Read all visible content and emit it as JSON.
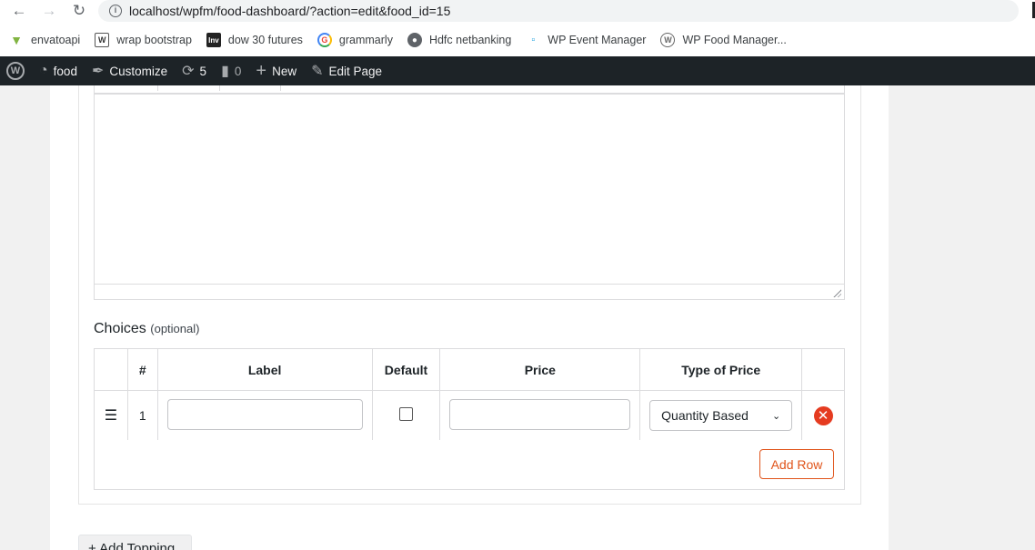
{
  "browser": {
    "url": "localhost/wpfm/food-dashboard/?action=edit&food_id=15",
    "bookmarks": [
      {
        "icon": "envato-icon",
        "label": "envatoapi"
      },
      {
        "icon": "wrap-bootstrap-icon",
        "label": "wrap bootstrap"
      },
      {
        "icon": "investing-icon",
        "label": "dow 30 futures"
      },
      {
        "icon": "grammarly-icon",
        "label": "grammarly"
      },
      {
        "icon": "globe-icon",
        "label": "Hdfc netbanking"
      },
      {
        "icon": "wp-event-icon",
        "label": "WP Event Manager"
      },
      {
        "icon": "wordpress-icon",
        "label": "WP Food Manager..."
      }
    ]
  },
  "adminbar": {
    "site": "food",
    "customize": "Customize",
    "updates": "5",
    "comments": "0",
    "new": "New",
    "edit_page": "Edit Page"
  },
  "choices": {
    "title": "Choices",
    "optional": "(optional)",
    "columns": [
      "#",
      "Label",
      "Default",
      "Price",
      "Type of Price"
    ],
    "rows": [
      {
        "index": "1",
        "label_value": "",
        "default_checked": false,
        "price_value": "",
        "price_type": "Quantity Based"
      }
    ],
    "add_row": "Add Row"
  },
  "add_topping": "+ Add Topping",
  "colors": {
    "accent": "#e0541b",
    "remove": "#e53b20",
    "adminbar": "#1d2327"
  }
}
